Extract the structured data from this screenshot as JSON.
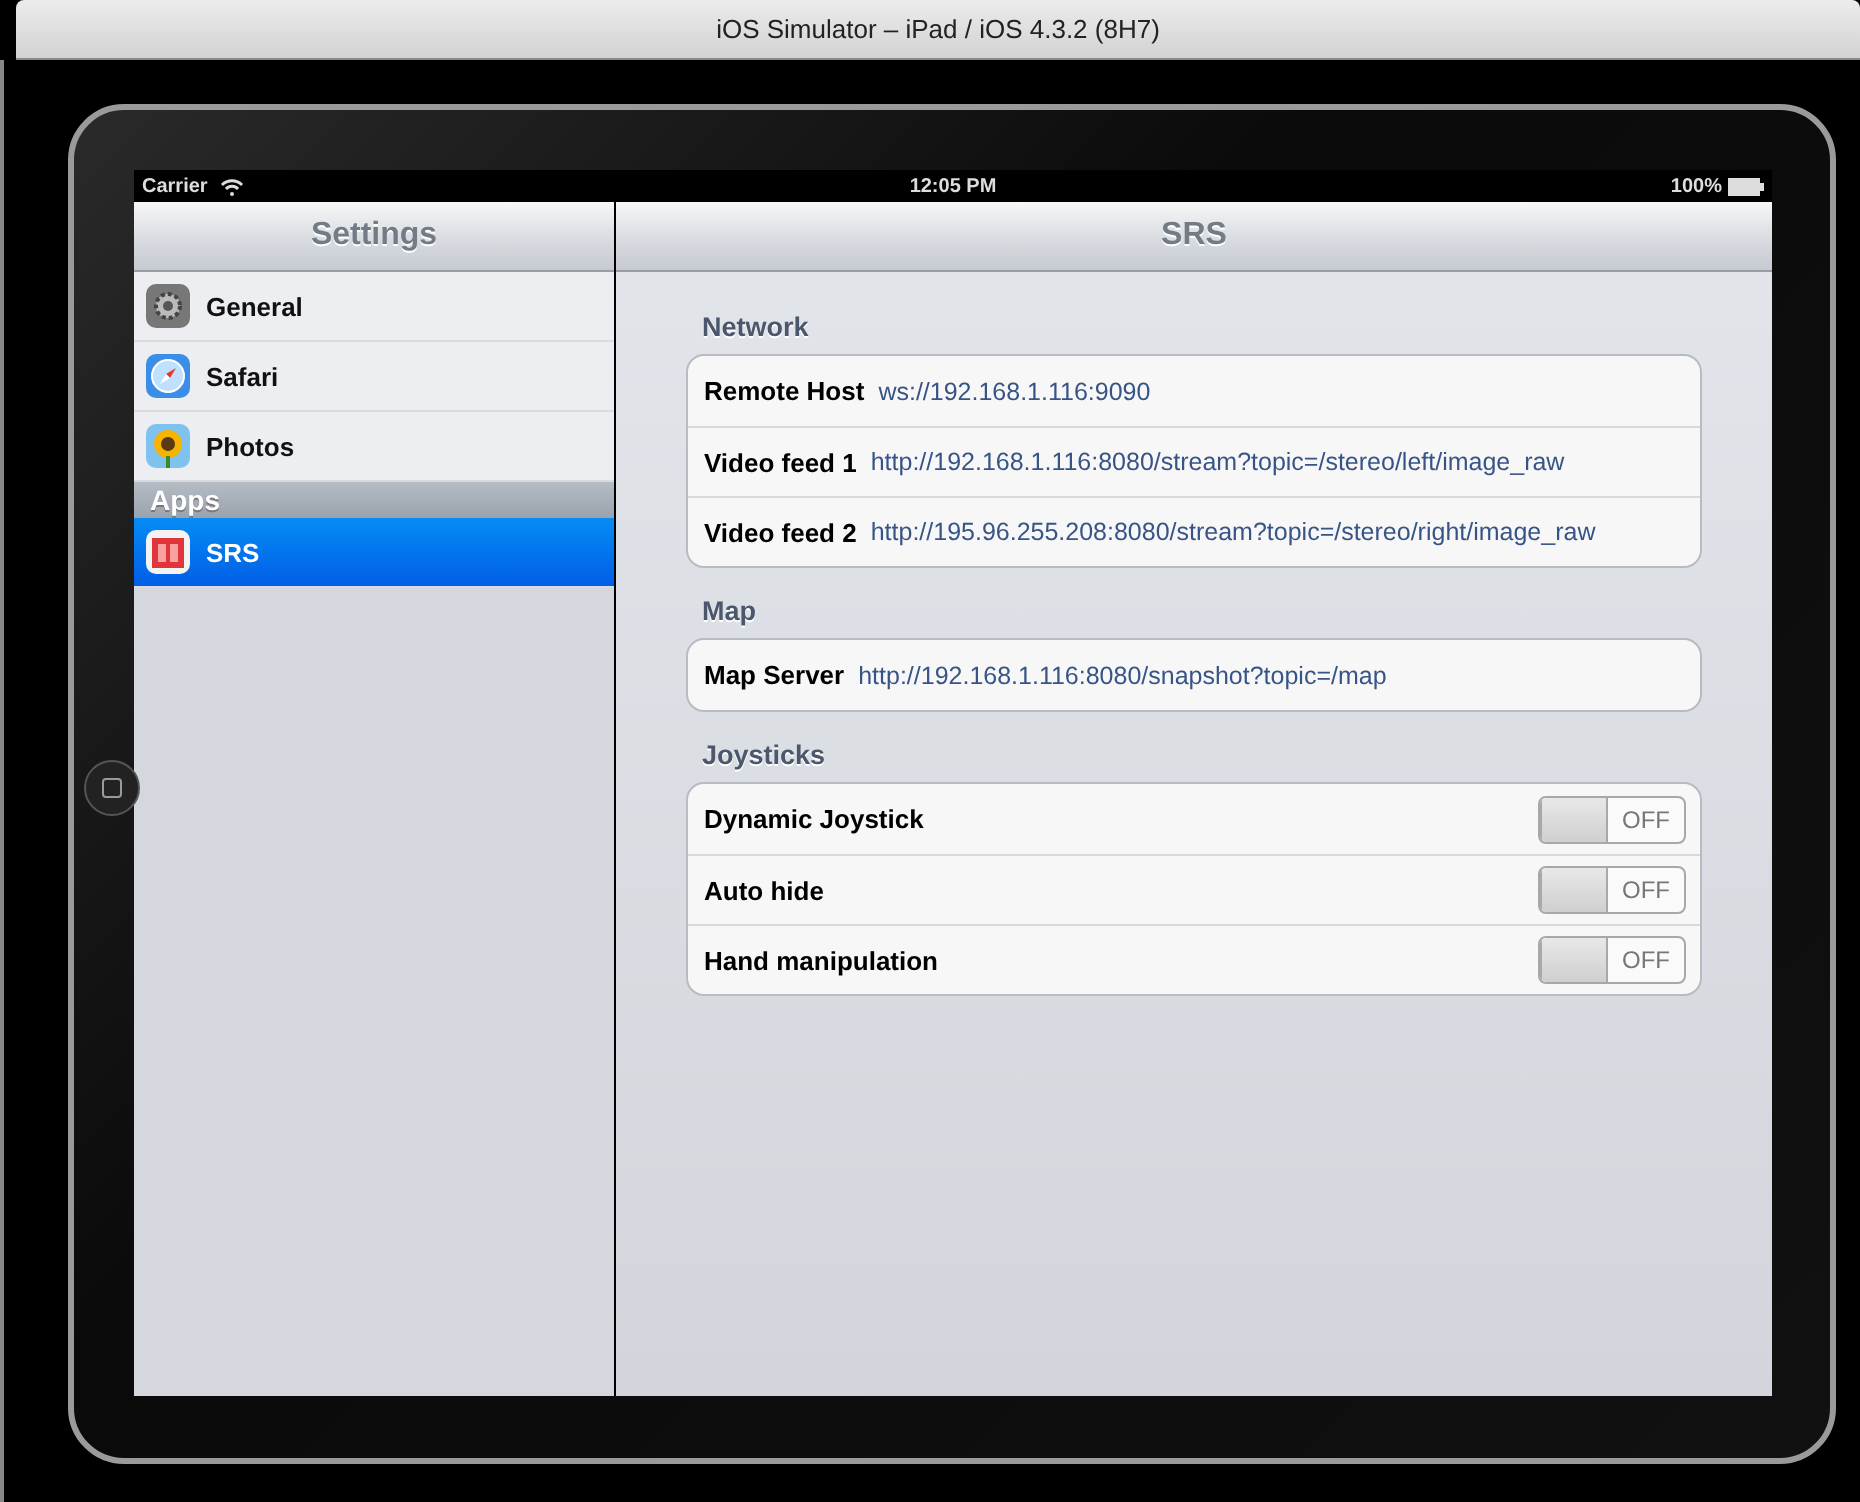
{
  "window": {
    "title": "iOS Simulator – iPad / iOS 4.3.2 (8H7)"
  },
  "status_bar": {
    "carrier": "Carrier",
    "time": "12:05 PM",
    "battery": "100%"
  },
  "sidebar": {
    "title": "Settings",
    "items": [
      {
        "kind": "gear",
        "label": "General",
        "selected": false
      },
      {
        "kind": "compass",
        "label": "Safari",
        "selected": false
      },
      {
        "kind": "flower",
        "label": "Photos",
        "selected": false
      },
      {
        "kind": "header",
        "label": "Apps"
      },
      {
        "kind": "app",
        "label": "SRS",
        "selected": true
      }
    ]
  },
  "detail": {
    "title": "SRS",
    "sections": [
      {
        "header": "Network",
        "rows": [
          {
            "kind": "text",
            "label": "Remote Host",
            "value": "ws://192.168.1.116:9090"
          },
          {
            "kind": "text",
            "label": "Video feed 1",
            "value": "http://192.168.1.116:8080/stream?topic=/stereo/left/image_raw"
          },
          {
            "kind": "text",
            "label": "Video feed 2",
            "value": "http://195.96.255.208:8080/stream?topic=/stereo/right/image_raw"
          }
        ]
      },
      {
        "header": "Map",
        "rows": [
          {
            "kind": "text",
            "label": "Map Server",
            "value": "http://192.168.1.116:8080/snapshot?topic=/map"
          }
        ]
      },
      {
        "header": "Joysticks",
        "rows": [
          {
            "kind": "switch",
            "label": "Dynamic Joystick",
            "on": false,
            "state_label": "OFF"
          },
          {
            "kind": "switch",
            "label": "Auto hide",
            "on": false,
            "state_label": "OFF"
          },
          {
            "kind": "switch",
            "label": "Hand manipulation",
            "on": false,
            "state_label": "OFF"
          }
        ]
      }
    ]
  }
}
